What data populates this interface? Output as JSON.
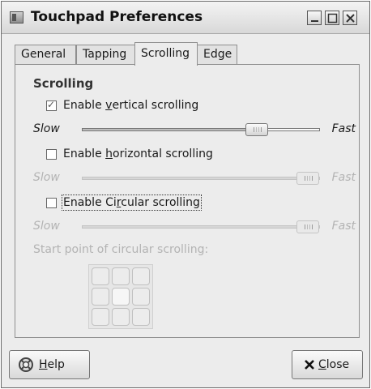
{
  "window": {
    "title": "Touchpad Preferences"
  },
  "tabs": [
    {
      "label": "General"
    },
    {
      "label": "Tapping"
    },
    {
      "label": "Scrolling"
    },
    {
      "label": "Edge"
    }
  ],
  "scrolling": {
    "section_title": "Scrolling",
    "vertical": {
      "label_pre": "Enable ",
      "label_mnemonic": "v",
      "label_post": "ertical scrolling",
      "checked": true,
      "slow_label": "Slow",
      "fast_label": "Fast",
      "speed_fraction": 0.76,
      "enabled": true
    },
    "horizontal": {
      "label_pre": "Enable ",
      "label_mnemonic": "h",
      "label_post": "orizontal scrolling",
      "checked": false,
      "slow_label": "Slow",
      "fast_label": "Fast",
      "speed_fraction": 1.0,
      "enabled": false
    },
    "circular": {
      "label_pre": "Enable Ci",
      "label_mnemonic": "r",
      "label_post": "cular scrolling",
      "checked": false,
      "slow_label": "Slow",
      "fast_label": "Fast",
      "speed_fraction": 1.0,
      "enabled": false
    },
    "start_point_label": "Start point of circular scrolling:"
  },
  "buttons": {
    "help": {
      "mnemonic": "H",
      "rest": "elp",
      "icon": "help-icon"
    },
    "close": {
      "mnemonic": "C",
      "rest": "lose",
      "icon": "close-x-icon"
    }
  }
}
